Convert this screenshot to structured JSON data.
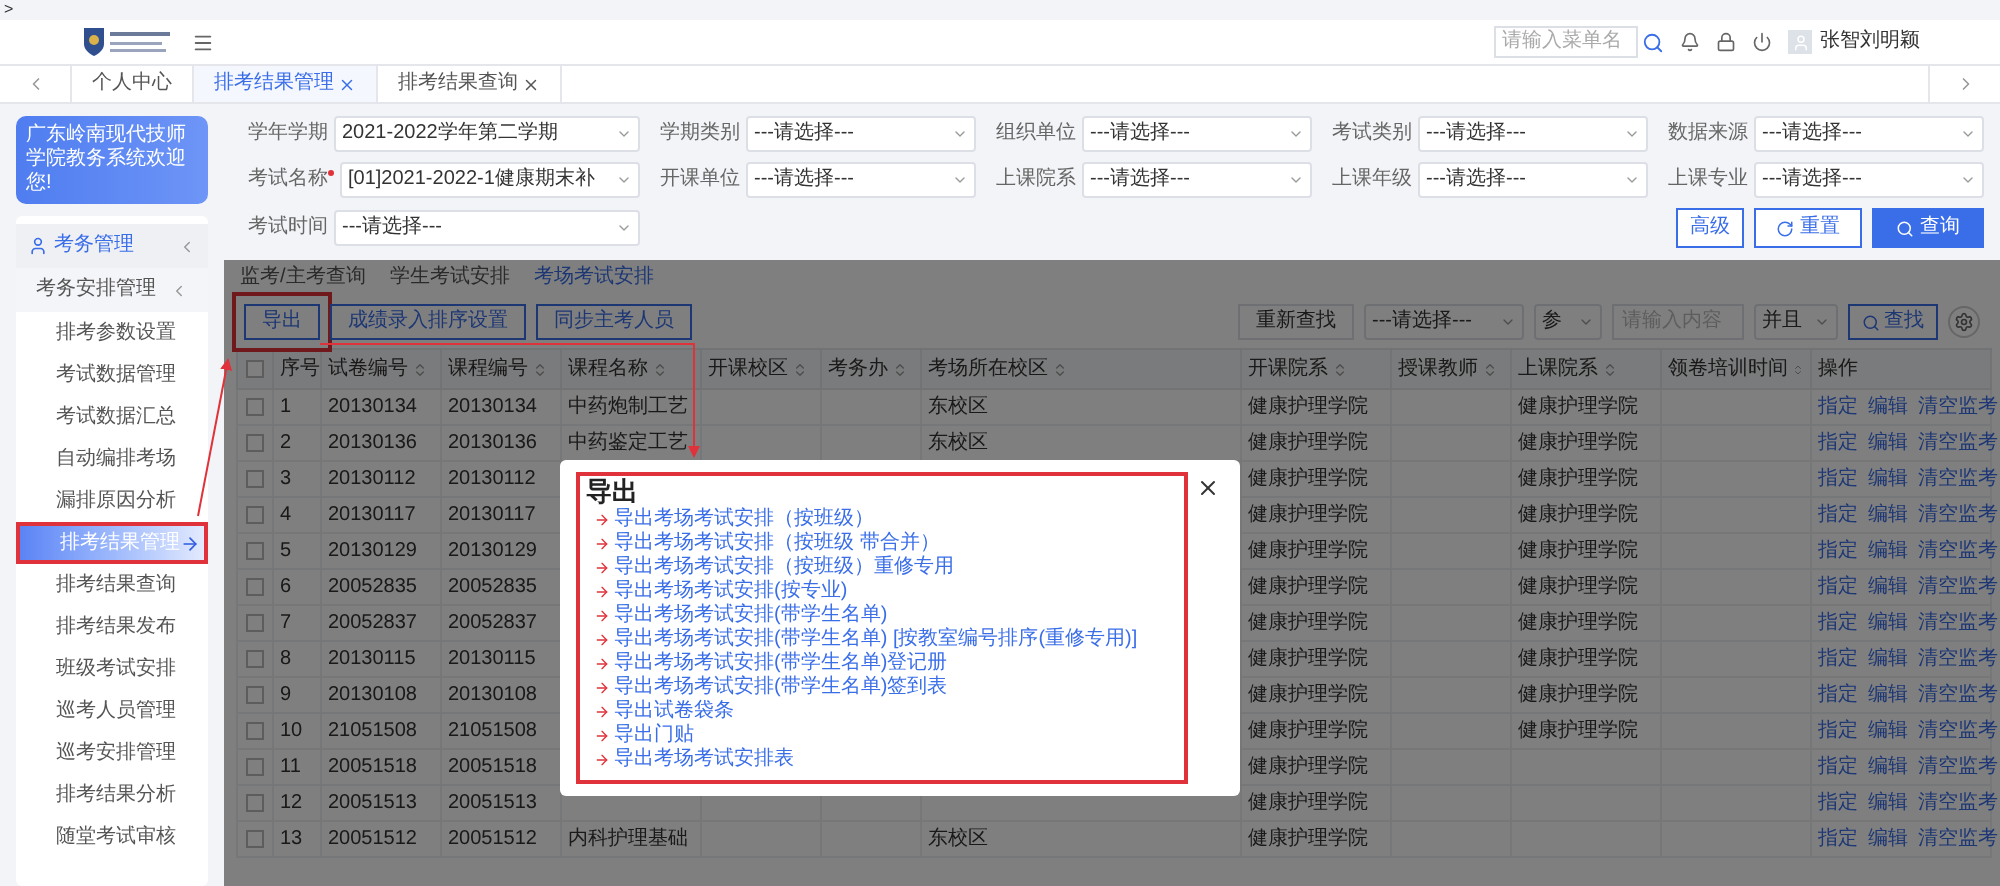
{
  "top_bar": {
    "prompt": ">",
    "search": {
      "placeholder": "请输入菜单名"
    },
    "user": "张智刘明颖"
  },
  "tabs": [
    {
      "label": "个人中心",
      "selected": false,
      "closable": false
    },
    {
      "label": "排考结果管理",
      "selected": true,
      "closable": true
    },
    {
      "label": "排考结果查询",
      "selected": false,
      "closable": true
    }
  ],
  "sidebar": {
    "welcome": "广东岭南现代技师学院教务系统欢迎您!",
    "items": [
      {
        "label": "考务管理",
        "expanded": true,
        "children": [
          {
            "label": "考务安排管理",
            "expanded": true,
            "children": [
              {
                "label": "排考参数设置",
                "selected": false
              },
              {
                "label": "考试数据管理",
                "selected": false
              },
              {
                "label": "考试数据汇总",
                "selected": false
              },
              {
                "label": "自动编排考场",
                "selected": false
              },
              {
                "label": "漏排原因分析",
                "selected": false
              },
              {
                "label": "排考结果管理",
                "selected": true
              },
              {
                "label": "排考结果查询",
                "selected": false
              },
              {
                "label": "排考结果发布",
                "selected": false
              },
              {
                "label": "班级考试安排",
                "selected": false
              },
              {
                "label": "巡考人员管理",
                "selected": false
              },
              {
                "label": "巡考安排管理",
                "selected": false
              },
              {
                "label": "排考结果分析",
                "selected": false
              },
              {
                "label": "随堂考试审核",
                "selected": false
              }
            ]
          }
        ]
      }
    ]
  },
  "filters": [
    {
      "label": "学年学期",
      "value": "2021-2022学年第二学期",
      "required": false
    },
    {
      "label": "学期类别",
      "value": "---请选择---",
      "required": false
    },
    {
      "label": "组织单位",
      "value": "---请选择---",
      "required": false
    },
    {
      "label": "考试类别",
      "value": "---请选择---",
      "required": false
    },
    {
      "label": "数据来源",
      "value": "---请选择---",
      "required": false
    },
    {
      "label": "考试名称",
      "value": "[01]2021-2022-1健康期末补",
      "required": true
    },
    {
      "label": "开课单位",
      "value": "---请选择---",
      "required": false
    },
    {
      "label": "上课院系",
      "value": "---请选择---",
      "required": false
    },
    {
      "label": "上课年级",
      "value": "---请选择---",
      "required": false
    },
    {
      "label": "上课专业",
      "value": "---请选择---",
      "required": false
    },
    {
      "label": "考试时间",
      "value": "---请选择---",
      "required": false
    }
  ],
  "filter_buttons": [
    {
      "label": "高级",
      "kind": "outline"
    },
    {
      "label": "重置",
      "kind": "reset"
    },
    {
      "label": "查询",
      "kind": "primary"
    }
  ],
  "sub_tabs": [
    {
      "label": "监考/主考查询",
      "selected": false
    },
    {
      "label": "学生考试安排",
      "selected": false
    },
    {
      "label": "考场考试安排",
      "selected": true
    }
  ],
  "toolbar": {
    "buttons": [
      "导出",
      "成绩录入排序设置",
      "同步主考人员"
    ],
    "reset": "重新查找",
    "field": "---请选择---",
    "operator": "参",
    "placeholder": "请输入内容",
    "logic": "并且",
    "submit": "查找"
  },
  "table": {
    "all_checked": false,
    "columns": [
      {
        "label": "序号",
        "sortable": false
      },
      {
        "label": "试卷编号",
        "sortable": true
      },
      {
        "label": "课程编号",
        "sortable": true
      },
      {
        "label": "课程名称",
        "sortable": true
      },
      {
        "label": "开课校区",
        "sortable": true
      },
      {
        "label": "考务办",
        "sortable": true
      },
      {
        "label": "考场所在校区",
        "sortable": true
      },
      {
        "label": "开课院系",
        "sortable": true
      },
      {
        "label": "授课教师",
        "sortable": true
      },
      {
        "label": "上课院系",
        "sortable": true
      },
      {
        "label": "领卷培训时间",
        "sortable": true
      },
      {
        "label": "操作",
        "sortable": false
      }
    ],
    "rows": [
      {
        "checked": false,
        "index": "1",
        "paper_no": "20130134",
        "course_no": "20130134",
        "course_name": "中药炮制工艺",
        "campus": "东校区",
        "dept": "健康护理学院",
        "class_dept": "健康护理学院",
        "actions": [
          "指定",
          "编辑",
          "清空监考"
        ]
      },
      {
        "checked": false,
        "index": "2",
        "paper_no": "20130136",
        "course_no": "20130136",
        "course_name": "中药鉴定工艺",
        "campus": "东校区",
        "dept": "健康护理学院",
        "class_dept": "健康护理学院",
        "actions": [
          "指定",
          "编辑",
          "清空监考"
        ]
      },
      {
        "checked": false,
        "index": "3",
        "paper_no": "20130112",
        "course_no": "20130112",
        "dept": "健康护理学院",
        "class_dept": "健康护理学院",
        "actions": [
          "指定",
          "编辑",
          "清空监考"
        ]
      },
      {
        "checked": false,
        "index": "4",
        "paper_no": "20130117",
        "course_no": "20130117",
        "dept": "健康护理学院",
        "class_dept": "健康护理学院",
        "actions": [
          "指定",
          "编辑",
          "清空监考"
        ]
      },
      {
        "checked": false,
        "index": "5",
        "paper_no": "20130129",
        "course_no": "20130129",
        "dept": "健康护理学院",
        "class_dept": "健康护理学院",
        "actions": [
          "指定",
          "编辑",
          "清空监考"
        ]
      },
      {
        "checked": false,
        "index": "6",
        "paper_no": "20052835",
        "course_no": "20052835",
        "dept": "健康护理学院",
        "class_dept": "健康护理学院",
        "actions": [
          "指定",
          "编辑",
          "清空监考"
        ]
      },
      {
        "checked": false,
        "index": "7",
        "paper_no": "20052837",
        "course_no": "20052837",
        "dept": "健康护理学院",
        "class_dept": "健康护理学院",
        "actions": [
          "指定",
          "编辑",
          "清空监考"
        ]
      },
      {
        "checked": false,
        "index": "8",
        "paper_no": "20130115",
        "course_no": "20130115",
        "dept": "健康护理学院",
        "class_dept": "健康护理学院",
        "actions": [
          "指定",
          "编辑",
          "清空监考"
        ]
      },
      {
        "checked": false,
        "index": "9",
        "paper_no": "20130108",
        "course_no": "20130108",
        "dept": "健康护理学院",
        "class_dept": "健康护理学院",
        "actions": [
          "指定",
          "编辑",
          "清空监考"
        ]
      },
      {
        "checked": false,
        "index": "10",
        "paper_no": "21051508",
        "course_no": "21051508",
        "dept": "健康护理学院",
        "class_dept": "健康护理学院",
        "actions": [
          "指定",
          "编辑",
          "清空监考"
        ]
      },
      {
        "checked": false,
        "index": "11",
        "paper_no": "20051518",
        "course_no": "20051518",
        "dept": "健康护理学院",
        "actions": [
          "指定",
          "编辑",
          "清空监考"
        ]
      },
      {
        "checked": false,
        "index": "12",
        "paper_no": "20051513",
        "course_no": "20051513",
        "dept": "健康护理学院",
        "actions": [
          "指定",
          "编辑",
          "清空监考"
        ]
      },
      {
        "checked": false,
        "index": "13",
        "paper_no": "20051512",
        "course_no": "20051512",
        "course_name": "内科护理基础",
        "campus": "东校区",
        "dept": "健康护理学院",
        "actions": [
          "指定",
          "编辑",
          "清空监考"
        ]
      }
    ]
  },
  "modal": {
    "title": "导出",
    "links": [
      "导出考场考试安排（按班级）",
      "导出考场考试安排（按班级 带合并）",
      "导出考场考试安排（按班级）重修专用",
      "导出考场考试安排(按专业)",
      "导出考场考试安排(带学生名单)",
      "导出考场考试安排(带学生名单) [按教室编号排序(重修专用)]",
      "导出考场考试安排(带学生名单)登记册",
      "导出考场考试安排(带学生名单)签到表",
      "导出试卷袋条",
      "导出门贴",
      "导出考场考试安排表"
    ]
  }
}
